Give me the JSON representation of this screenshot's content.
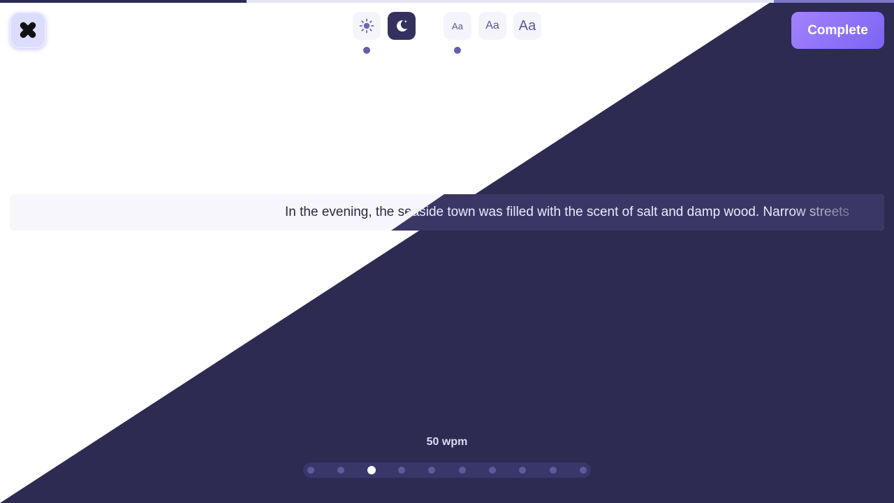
{
  "progress": {
    "fraction": 0.276
  },
  "close_button": {
    "icon": "close-icon"
  },
  "theme": {
    "options": [
      {
        "name": "light",
        "icon": "sun-icon",
        "selected": false
      },
      {
        "name": "dark",
        "icon": "moon-icon",
        "selected": true
      }
    ]
  },
  "font_size": {
    "options": [
      {
        "label": "Aa",
        "size": "small",
        "selected": true
      },
      {
        "label": "Aa",
        "size": "medium",
        "selected": false
      },
      {
        "label": "Aa",
        "size": "large",
        "selected": false
      }
    ]
  },
  "actions": {
    "complete_label": "Complete"
  },
  "reading": {
    "text": "In the evening, the seaside town was filled with the scent of salt and damp wood. Narrow streets"
  },
  "speed": {
    "label": "50 wpm",
    "steps": 10,
    "selected_index": 2
  },
  "colors": {
    "dark_bg": "#2d2b52",
    "accent": "#8b6dfb",
    "indicator": "#625eac"
  }
}
